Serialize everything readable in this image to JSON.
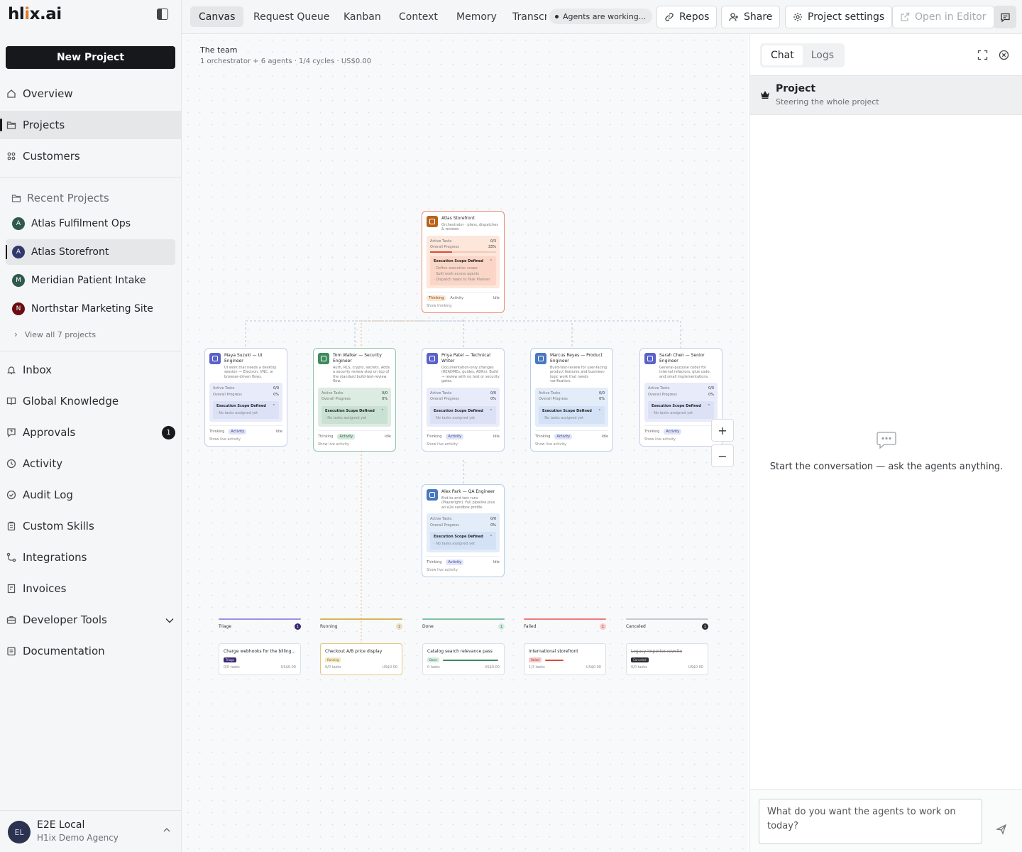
{
  "app": {
    "logo": "hlix.ai",
    "logo_parts": [
      "hl",
      "i",
      "x.ai"
    ]
  },
  "sidebar": {
    "new_project": "New Project",
    "nav_top": [
      {
        "label": "Overview",
        "icon": "home-icon"
      },
      {
        "label": "Projects",
        "icon": "folder-icon",
        "active": true
      },
      {
        "label": "Customers",
        "icon": "users-icon"
      }
    ],
    "recent_heading": "Recent Projects",
    "recent": [
      {
        "initial": "A",
        "name": "Atlas Fulfilment Ops",
        "color": "#2f5a4b"
      },
      {
        "initial": "A",
        "name": "Atlas Storefront",
        "color": "#30386e",
        "active": true
      },
      {
        "initial": "M",
        "name": "Meridian Patient Intake",
        "color": "#2f5a4b"
      },
      {
        "initial": "N",
        "name": "Northstar Marketing Site",
        "color": "#6a0d13"
      }
    ],
    "view_all": "View all 7 projects",
    "nav_bottom": [
      {
        "label": "Inbox",
        "icon": "bell-icon"
      },
      {
        "label": "Global Knowledge",
        "icon": "book-icon"
      },
      {
        "label": "Approvals",
        "icon": "question-bubble-icon",
        "badge": "1"
      },
      {
        "label": "Activity",
        "icon": "clock-icon"
      },
      {
        "label": "Audit Log",
        "icon": "shield-check-icon"
      },
      {
        "label": "Custom Skills",
        "icon": "clipboard-icon"
      },
      {
        "label": "Integrations",
        "icon": "flow-icon"
      },
      {
        "label": "Invoices",
        "icon": "receipt-icon"
      },
      {
        "label": "Developer Tools",
        "icon": "toolbox-icon"
      },
      {
        "label": "Documentation",
        "icon": "document-icon"
      }
    ],
    "user": {
      "initials": "EL",
      "name": "E2E Local",
      "org": "H1ix Demo Agency"
    }
  },
  "topbar": {
    "tabs": [
      "Canvas",
      "Request Queue",
      "Kanban",
      "Context",
      "Memory",
      "Transcripts"
    ],
    "active_tab": "Canvas",
    "status": "Agents are working...",
    "repos": "Repos",
    "share": "Share",
    "project_settings": "Project settings",
    "open_in_editor": "Open in Editor"
  },
  "canvas": {
    "team_title": "The team",
    "team_sub": "1 orchestrator + 6 agents · 1/4 cycles · US$0.00",
    "labels": {
      "active_tasks": "Active Tasks",
      "overall_progress": "Overall Progress",
      "scope": "Execution Scope Defined",
      "no_tasks": "No tasks assigned yet",
      "thinking": "Thinking",
      "activity": "Activity",
      "idle": "Idle",
      "show_thinking": "Show thinking",
      "show_live": "Show live activity"
    },
    "orchestrator": {
      "name": "Atlas Storefront",
      "desc": "Orchestrator · plans, dispatches & reviews",
      "active_tasks": "0/3",
      "progress": "33%",
      "progress_value": 0.33,
      "steps": [
        "Define execution scope",
        "Split work across agents",
        "Dispatch tasks to Task Planner"
      ]
    },
    "agents": [
      {
        "name": "Maya Suzuki — UI Engineer",
        "desc": "UI work that needs a desktop session — Electron, VNC, or browser-driven flows.",
        "active_tasks": "0/0",
        "progress": "0%"
      },
      {
        "name": "Tom Walker — Security Engineer",
        "desc": "Auth, RLS, crypto, secrets. Adds a security review step on top of the standard build-test-review flow.",
        "active_tasks": "0/0",
        "progress": "0%"
      },
      {
        "name": "Priya Patel — Technical Writer",
        "desc": "Documentation-only changes (READMEs, guides, ADRs). Build → review with no test or security gates.",
        "active_tasks": "0/0",
        "progress": "0%"
      },
      {
        "name": "Marcus Reyes — Product Engineer",
        "desc": "Build-test-review for user-facing product features and business-logic work that needs verification.",
        "active_tasks": "0/0",
        "progress": "0%"
      },
      {
        "name": "Sarah Chen — Senior Engineer",
        "desc": "General-purpose coder for internal refactors, glue code, and small implementations.",
        "active_tasks": "0/0",
        "progress": "0%"
      },
      {
        "name": "Alex Park — QA Engineer",
        "desc": "End-to-end test runs (Playwright). Full pipeline plus an e2e sandbox profile.",
        "active_tasks": "0/0",
        "progress": "0%"
      }
    ],
    "zoom_in": "+",
    "zoom_out": "−",
    "columns": [
      {
        "name": "Triage",
        "count": "1",
        "color": "#9f8fe6",
        "badge_bg": "#3a2a6e"
      },
      {
        "name": "Running",
        "count": "1",
        "color": "#d9b45a",
        "badge_bg": "#e8dfc6"
      },
      {
        "name": "Done",
        "count": "1",
        "color": "#7fc2a0",
        "badge_bg": "#d4ece0"
      },
      {
        "name": "Failed",
        "count": "1",
        "color": "#ef7a7a",
        "badge_bg": "#f7caca"
      },
      {
        "name": "Canceled",
        "count": "1",
        "color": "#c7c9cc",
        "badge_bg": "#2a2d31"
      }
    ],
    "tasks": [
      {
        "title": "Charge webhooks for the billing...",
        "status": "Triage",
        "tasks": "0/0 tasks",
        "cost": "US$0.00",
        "progress": 0
      },
      {
        "title": "Checkout A/B price display",
        "status": "Running",
        "tasks": "0/0 tasks",
        "cost": "US$0.00",
        "progress": 0
      },
      {
        "title": "Catalog search relevance pass",
        "status": "Done",
        "tasks": "0 tasks",
        "cost": "US$0.00",
        "progress": 1
      },
      {
        "title": "International storefront",
        "status": "Failed",
        "tasks": "1/3 tasks",
        "cost": "US$0.00",
        "progress": 0.33
      },
      {
        "title": "Legacy importer rewrite",
        "status": "Canceled",
        "tasks": "0/0 tasks",
        "cost": "US$0.00",
        "progress": 0
      }
    ]
  },
  "panel": {
    "tabs": [
      "Chat",
      "Logs"
    ],
    "context_title": "Project",
    "context_sub": "Steering the whole project",
    "empty": "Start the conversation — ask the agents anything.",
    "placeholder": "What do you want the agents to work on today?"
  }
}
